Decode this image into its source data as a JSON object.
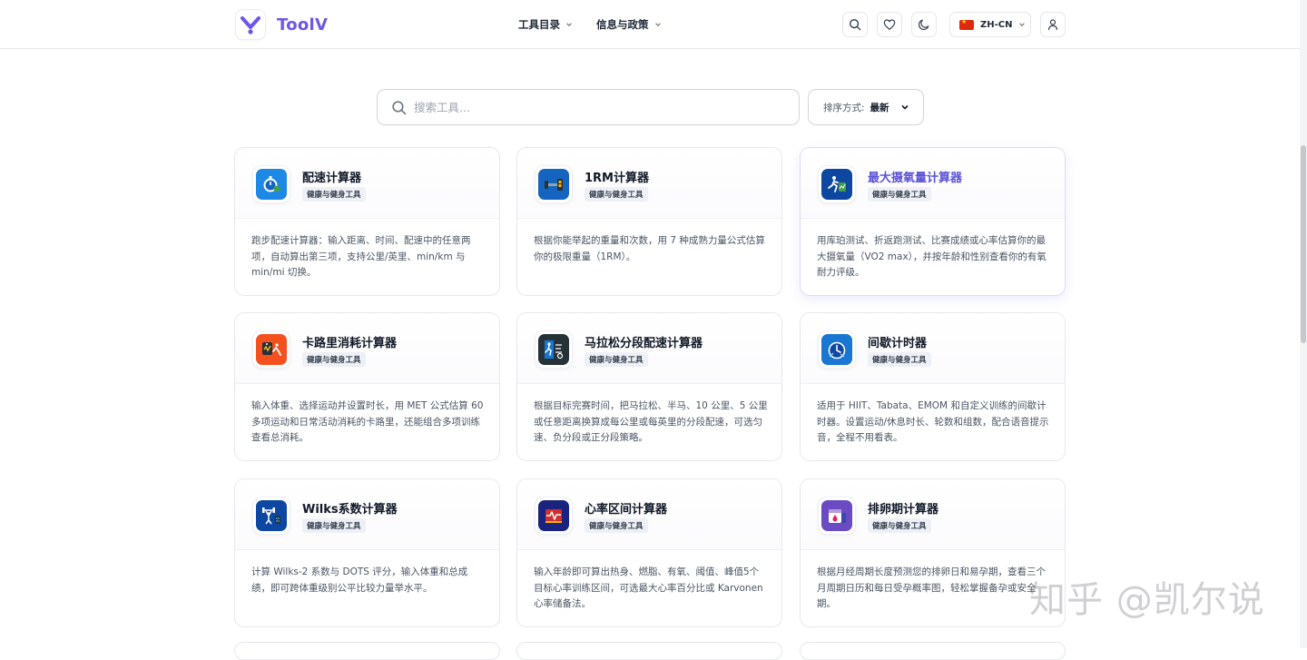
{
  "header": {
    "brand": "ToolV",
    "nav": [
      {
        "label": "工具目录"
      },
      {
        "label": "信息与政策"
      }
    ],
    "lang_label": "ZH-CN"
  },
  "search": {
    "placeholder": "搜索工具..."
  },
  "sort": {
    "label": "排序方式:",
    "value": "最新"
  },
  "cards": [
    {
      "title": "配速计算器",
      "tag": "健康与健身工具",
      "desc": "跑步配速计算器：输入距离、时间、配速中的任意两项，自动算出第三项，支持公里/英里、min/km 与 min/mi 切换。",
      "icon": "stopwatch-icon",
      "color": "#1e88e5"
    },
    {
      "title": "1RM计算器",
      "tag": "健康与健身工具",
      "desc": "根据你能举起的重量和次数，用 7 种成熟力量公式估算你的极限重量（1RM）。",
      "icon": "dumbbell-icon",
      "color": "#1565c0"
    },
    {
      "title": "最大摄氧量计算器",
      "tag": "健康与健身工具",
      "desc": "用库珀测试、折返跑测试、比赛成绩或心率估算你的最大摄氧量（VO2 max），并按年龄和性别查看你的有氧耐力评级。",
      "icon": "runner-icon",
      "color": "#0d47a1"
    },
    {
      "title": "卡路里消耗计算器",
      "tag": "健康与健身工具",
      "desc": "输入体重、选择运动并设置时长，用 MET 公式估算 60 多项运动和日常活动消耗的卡路里，还能组合多项训练查看总消耗。",
      "icon": "calorie-icon",
      "color": "#f4511e"
    },
    {
      "title": "马拉松分段配速计算器",
      "tag": "健康与健身工具",
      "desc": "根据目标完赛时间，把马拉松、半马、10 公里、5 公里或任意距离换算成每公里或每英里的分段配速，可选匀速、负分段或正分段策略。",
      "icon": "marathon-icon",
      "color": "#263238"
    },
    {
      "title": "间歇计时器",
      "tag": "健康与健身工具",
      "desc": "适用于 HIIT、Tabata、EMOM 和自定义训练的间歇计时器。设置运动/休息时长、轮数和组数，配合语音提示音，全程不用看表。",
      "icon": "timer-icon",
      "color": "#1976d2"
    },
    {
      "title": "Wilks系数计算器",
      "tag": "健康与健身工具",
      "desc": "计算 Wilks-2 系数与 DOTS 评分，输入体重和总成绩，即可跨体重级别公平比较力量举水平。",
      "icon": "weightlift-icon",
      "color": "#0d47a1"
    },
    {
      "title": "心率区间计算器",
      "tag": "健康与健身工具",
      "desc": "输入年龄即可算出热身、燃脂、有氧、阈值、峰值5个目标心率训练区间，可选最大心率百分比或 Karvonen 心率储备法。",
      "icon": "heartrate-icon",
      "color": "#1a237e"
    },
    {
      "title": "排卵期计算器",
      "tag": "健康与健身工具",
      "desc": "根据月经周期长度预测您的排卵日和易孕期，查看三个月周期日历和每日受孕概率图，轻松掌握备孕或安全期。",
      "icon": "calendar-drop-icon",
      "color": "#6a4bc4"
    }
  ],
  "watermark": "知乎 @凯尔说"
}
